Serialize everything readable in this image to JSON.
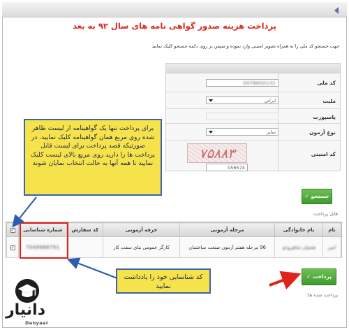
{
  "page_title": "پرداخت هزینه صدور گواهی نامه های سال ۹۲ به بعد",
  "instruction": "جهت جستجو کد ملی را به همراه تصویر امنیتی وارد نموده و سپس بر روی دکمه جستجو کلیک نمایید",
  "form": {
    "national_code_label": "کد ملی",
    "national_code_value": "0078650131",
    "nationality_label": "ملیت",
    "nationality_value": "ایرانی",
    "passport_label": "پاسپورت",
    "passport_value": "",
    "exam_type_label": "نوع آزمون",
    "exam_type_value": "سایر",
    "security_code_label": "کد امنیتی",
    "captcha_text": "۷۵۸۸۳",
    "security_code_value": "056574"
  },
  "search_button": "جستجو",
  "payable_section_label": "قابل پرداخت:",
  "table": {
    "headers": [
      "نام",
      "نام خانوادگی",
      "مرحله آزمونی",
      "حرفه آزمونی",
      "کد سفارش",
      "شماره شناسایی"
    ],
    "row": {
      "name": "امیر",
      "family": "فتحیان شاهرودی",
      "stage": "96 مرحله هفتم آزمون صنعت ساختمان",
      "profession": "کارگر عمومی بنای سفت کار",
      "order_code": "",
      "id_number": "7049988791"
    }
  },
  "pay_button": "پرداخت",
  "paid_section_label": "پرداخت شده ها:",
  "callout_main": "برای پرداخت تنها یک گواهینامه از لیست ظاهر شده روی مربع همان گواهینامه کلیک نمایید. در صورتیکه قصد پرداخت برای لیست قابل پرداخت ها را دارید روی مربع بالای لیست کلیک نمایید تا همه آنها به حالت انتخاب نمایان شوند",
  "callout_id": "کد شناسایی خود را یادداشت نمایید",
  "logo": {
    "text": "دانیار",
    "subtext": "Danyaar"
  },
  "colors": {
    "title_red": "#d8281f",
    "callout_yellow": "#f6e24b",
    "callout_border": "#3a63b0",
    "button_green": "#3f9a2e",
    "annotation_red": "#e0221a"
  }
}
